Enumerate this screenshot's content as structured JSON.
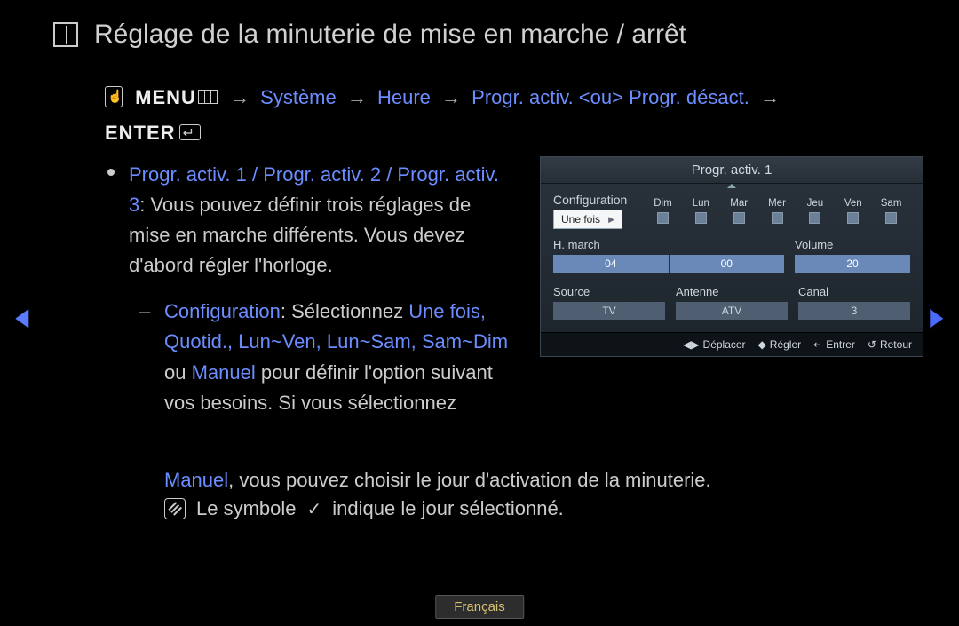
{
  "title": "Réglage de la minuterie de mise en marche / arrêt",
  "breadcrumb": {
    "menu": "MENU",
    "path1": "Système",
    "path2": "Heure",
    "path3": "Progr. activ. <ou> Progr. désact.",
    "enter": "ENTER",
    "arrow": "→"
  },
  "text": {
    "p1a": "Progr. activ. 1 / Progr. activ. 2 / Progr. activ. 3",
    "p1b": ": Vous pouvez définir trois réglages de mise en marche différents. Vous devez d'abord régler l'horloge.",
    "cfg_label": "Configuration",
    "cfg_after": ": Sélectionnez ",
    "options": "Une fois, Quotid., Lun~Ven, Lun~Sam, Sam~Dim",
    "ou": " ou ",
    "manuel": "Manuel",
    "tail": " pour définir l'option suivant vos besoins. Si vous sélectionnez ",
    "manuel2": "Manuel",
    "tail2": ", vous pouvez choisir le jour d'activation de la minuterie.",
    "note": "Le symbole",
    "note2": "indique le jour sélectionné."
  },
  "panel": {
    "title": "Progr. activ. 1",
    "config_label": "Configuration",
    "config_value": "Une fois",
    "days": [
      "Dim",
      "Lun",
      "Mar",
      "Mer",
      "Jeu",
      "Ven",
      "Sam"
    ],
    "hmarch_label": "H. march",
    "hmarch_h": "04",
    "hmarch_m": "00",
    "volume_label": "Volume",
    "volume_value": "20",
    "source_label": "Source",
    "source_value": "TV",
    "antenne_label": "Antenne",
    "antenne_value": "ATV",
    "canal_label": "Canal",
    "canal_value": "3",
    "footer": {
      "move": "Déplacer",
      "adjust": "Régler",
      "enter": "Entrer",
      "return": "Retour"
    }
  },
  "language": "Français"
}
